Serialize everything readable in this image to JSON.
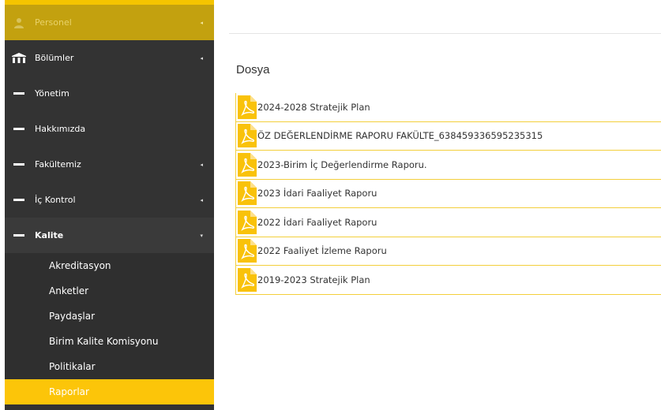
{
  "sidebar": {
    "items": [
      {
        "label": "Personel",
        "icon": "user-icon",
        "caret": "◂"
      },
      {
        "label": "Bölümler",
        "icon": "building-icon",
        "caret": "◂"
      },
      {
        "label": "Yönetim",
        "icon": "dash-icon",
        "caret": ""
      },
      {
        "label": "Hakkımızda",
        "icon": "dash-icon",
        "caret": ""
      },
      {
        "label": "Fakültemiz",
        "icon": "dash-icon",
        "caret": "◂"
      },
      {
        "label": "İç Kontrol",
        "icon": "dash-icon",
        "caret": "◂"
      },
      {
        "label": "Kalite",
        "icon": "dash-icon",
        "caret": "▾"
      }
    ],
    "sub_items": [
      {
        "label": "Akreditasyon"
      },
      {
        "label": "Anketler"
      },
      {
        "label": "Paydaşlar"
      },
      {
        "label": "Birim Kalite Komisyonu"
      },
      {
        "label": "Politikalar"
      },
      {
        "label": "Raporlar",
        "active": true
      }
    ]
  },
  "main": {
    "section_title": "Dosya",
    "files": [
      {
        "name": "2024-2028 Stratejik Plan"
      },
      {
        "name": "ÖZ DEĞERLENDİRME RAPORU FAKÜLTE_638459336595235315"
      },
      {
        "name": "2023-Birim İç Değerlendirme Raporu."
      },
      {
        "name": "2023 İdari Faaliyet Raporu"
      },
      {
        "name": "2022 İdari Faaliyet Raporu"
      },
      {
        "name": "2022 Faaliyet İzleme Raporu"
      },
      {
        "name": "2019-2023 Stratejik Plan"
      }
    ]
  },
  "colors": {
    "accent": "#fcc509",
    "sidebar_bg": "#333333",
    "personel_bg": "#c3a10f"
  }
}
